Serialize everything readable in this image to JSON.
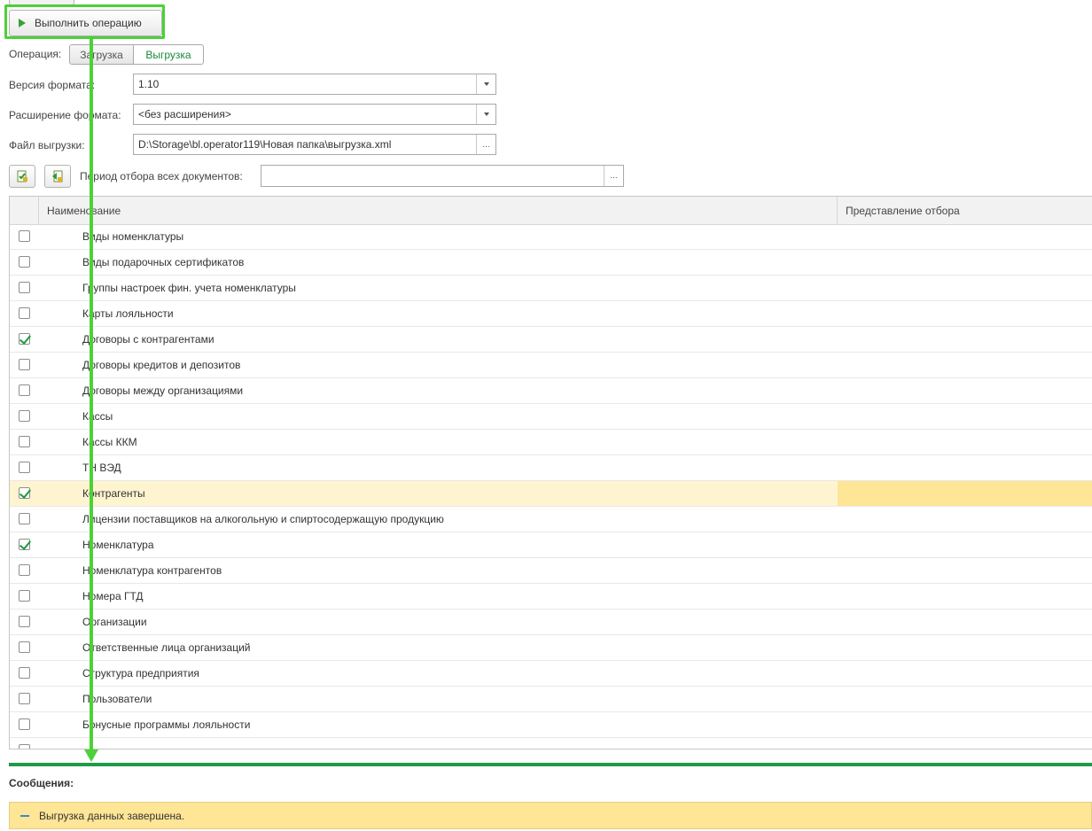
{
  "toolbar": {
    "execute_label": "Выполнить операцию"
  },
  "operation": {
    "label": "Операция:",
    "options": [
      "Загрузка",
      "Выгрузка"
    ],
    "selected": "Выгрузка"
  },
  "format_version": {
    "label": "Версия формата:",
    "value": "1.10"
  },
  "format_extension": {
    "label": "Расширение формата:",
    "value": "<без расширения>"
  },
  "export_file": {
    "label": "Файл выгрузки:",
    "value": "D:\\Storage\\bl.operator119\\Новая папка\\выгрузка.xml",
    "button": "..."
  },
  "period": {
    "label": "Период отбора всех документов:",
    "value": "",
    "button": "..."
  },
  "table": {
    "columns": [
      "Наименование",
      "Представление отбора"
    ],
    "rows": [
      {
        "name": "Виды номенклатуры",
        "checked": false
      },
      {
        "name": "Виды подарочных сертификатов",
        "checked": false
      },
      {
        "name": "Группы настроек фин. учета номенклатуры",
        "checked": false
      },
      {
        "name": "Карты лояльности",
        "checked": false
      },
      {
        "name": "Договоры с контрагентами",
        "checked": true
      },
      {
        "name": "Договоры кредитов и депозитов",
        "checked": false
      },
      {
        "name": "Договоры между организациями",
        "checked": false
      },
      {
        "name": "Кассы",
        "checked": false
      },
      {
        "name": "Кассы ККМ",
        "checked": false
      },
      {
        "name": "ТН ВЭД",
        "checked": false
      },
      {
        "name": "Контрагенты",
        "checked": true,
        "selected": true
      },
      {
        "name": "Лицензии поставщиков на алкогольную и спиртосодержащую продукцию",
        "checked": false
      },
      {
        "name": "Номенклатура",
        "checked": true
      },
      {
        "name": "Номенклатура контрагентов",
        "checked": false
      },
      {
        "name": "Номера ГТД",
        "checked": false
      },
      {
        "name": "Организации",
        "checked": false
      },
      {
        "name": "Ответственные лица организаций",
        "checked": false
      },
      {
        "name": "Структура предприятия",
        "checked": false
      },
      {
        "name": "Пользователи",
        "checked": false
      },
      {
        "name": "Бонусные программы лояльности",
        "checked": false
      },
      {
        "name": "",
        "checked": false
      }
    ]
  },
  "messages": {
    "title": "Сообщения:",
    "items": [
      "Выгрузка данных завершена."
    ]
  },
  "colors": {
    "accent_green": "#1e9a4b",
    "highlight_frame": "#4cd137",
    "selected_row": "#fff4d0",
    "message_bg": "#ffe596"
  }
}
